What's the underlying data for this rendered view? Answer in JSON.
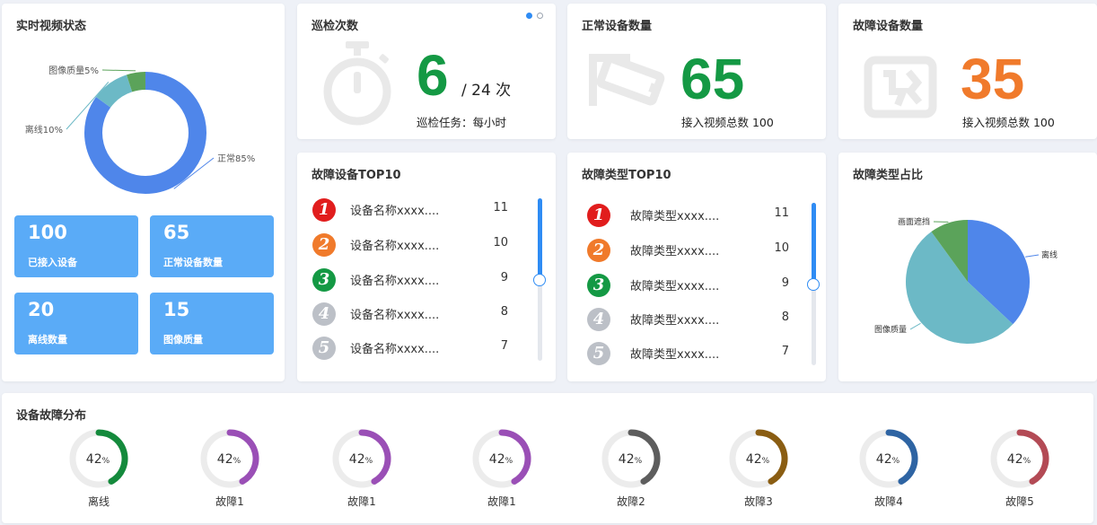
{
  "realtime": {
    "title": "实时视频状态",
    "donut": [
      {
        "label": "正常85%",
        "value": 85,
        "color": "#4f86ea"
      },
      {
        "label": "离线10%",
        "value": 10,
        "color": "#6cb9c6"
      },
      {
        "label": "图像质量5%",
        "value": 5,
        "color": "#5ba35a"
      }
    ],
    "stats": [
      {
        "num": "100",
        "label": "已接入设备"
      },
      {
        "num": "65",
        "label": "正常设备数量"
      },
      {
        "num": "20",
        "label": "离线数量"
      },
      {
        "num": "15",
        "label": "图像质量"
      }
    ]
  },
  "inspection": {
    "title": "巡检次数",
    "count": "6",
    "total": "/ 24 次",
    "task": "巡检任务：每小时",
    "page_dots": [
      "active",
      "inactive"
    ],
    "icon": "stopwatch-icon"
  },
  "normal": {
    "title": "正常设备数量",
    "count": "65",
    "footer": "接入视频总数 100",
    "color": "#149944",
    "icon": "camera-icon"
  },
  "faulty": {
    "title": "故障设备数量",
    "count": "35",
    "footer": "接入视频总数 100",
    "color": "#f07a2b",
    "icon": "broken-image-icon"
  },
  "top_devices": {
    "title": "故障设备TOP10",
    "scroll_progress": 0.48,
    "items": [
      {
        "rank": "1",
        "name": "设备名称xxxx....",
        "value": "11",
        "color": "#e11d1d"
      },
      {
        "rank": "2",
        "name": "设备名称xxxx....",
        "value": "10",
        "color": "#f07a2b"
      },
      {
        "rank": "3",
        "name": "设备名称xxxx....",
        "value": "9",
        "color": "#149944"
      },
      {
        "rank": "4",
        "name": "设备名称xxxx....",
        "value": "8",
        "color": "#bcc0c7"
      },
      {
        "rank": "5",
        "name": "设备名称xxxx....",
        "value": "7",
        "color": "#bcc0c7"
      }
    ]
  },
  "top_types": {
    "title": "故障类型TOP10",
    "scroll_progress": 0.48,
    "items": [
      {
        "rank": "1",
        "name": "故障类型xxxx....",
        "value": "11",
        "color": "#e11d1d"
      },
      {
        "rank": "2",
        "name": "故障类型xxxx....",
        "value": "10",
        "color": "#f07a2b"
      },
      {
        "rank": "3",
        "name": "故障类型xxxx....",
        "value": "9",
        "color": "#149944"
      },
      {
        "rank": "4",
        "name": "故障类型xxxx....",
        "value": "8",
        "color": "#bcc0c7"
      },
      {
        "rank": "5",
        "name": "故障类型xxxx....",
        "value": "7",
        "color": "#bcc0c7"
      }
    ]
  },
  "fault_ratio": {
    "title": "故障类型占比",
    "pie": [
      {
        "label": "离线",
        "value": 37,
        "color": "#4f86ea"
      },
      {
        "label": "图像质量",
        "value": 53,
        "color": "#6cb9c6"
      },
      {
        "label": "画面遮挡",
        "value": 10,
        "color": "#5ba35a"
      }
    ]
  },
  "distribution": {
    "title": "设备故障分布",
    "items": [
      {
        "label": "离线",
        "value": "42",
        "unit": "%",
        "percent": 42,
        "color": "#148a3c"
      },
      {
        "label": "故障1",
        "value": "42",
        "unit": "%",
        "percent": 42,
        "color": "#9a4fb6"
      },
      {
        "label": "故障1",
        "value": "42",
        "unit": "%",
        "percent": 42,
        "color": "#9a4fb6"
      },
      {
        "label": "故障1",
        "value": "42",
        "unit": "%",
        "percent": 42,
        "color": "#9a4fb6"
      },
      {
        "label": "故障2",
        "value": "42",
        "unit": "%",
        "percent": 42,
        "color": "#5d5d5d"
      },
      {
        "label": "故障3",
        "value": "42",
        "unit": "%",
        "percent": 42,
        "color": "#8a5d12"
      },
      {
        "label": "故障4",
        "value": "42",
        "unit": "%",
        "percent": 42,
        "color": "#2e64a3"
      },
      {
        "label": "故障5",
        "value": "42",
        "unit": "%",
        "percent": 42,
        "color": "#b34a55"
      }
    ]
  }
}
